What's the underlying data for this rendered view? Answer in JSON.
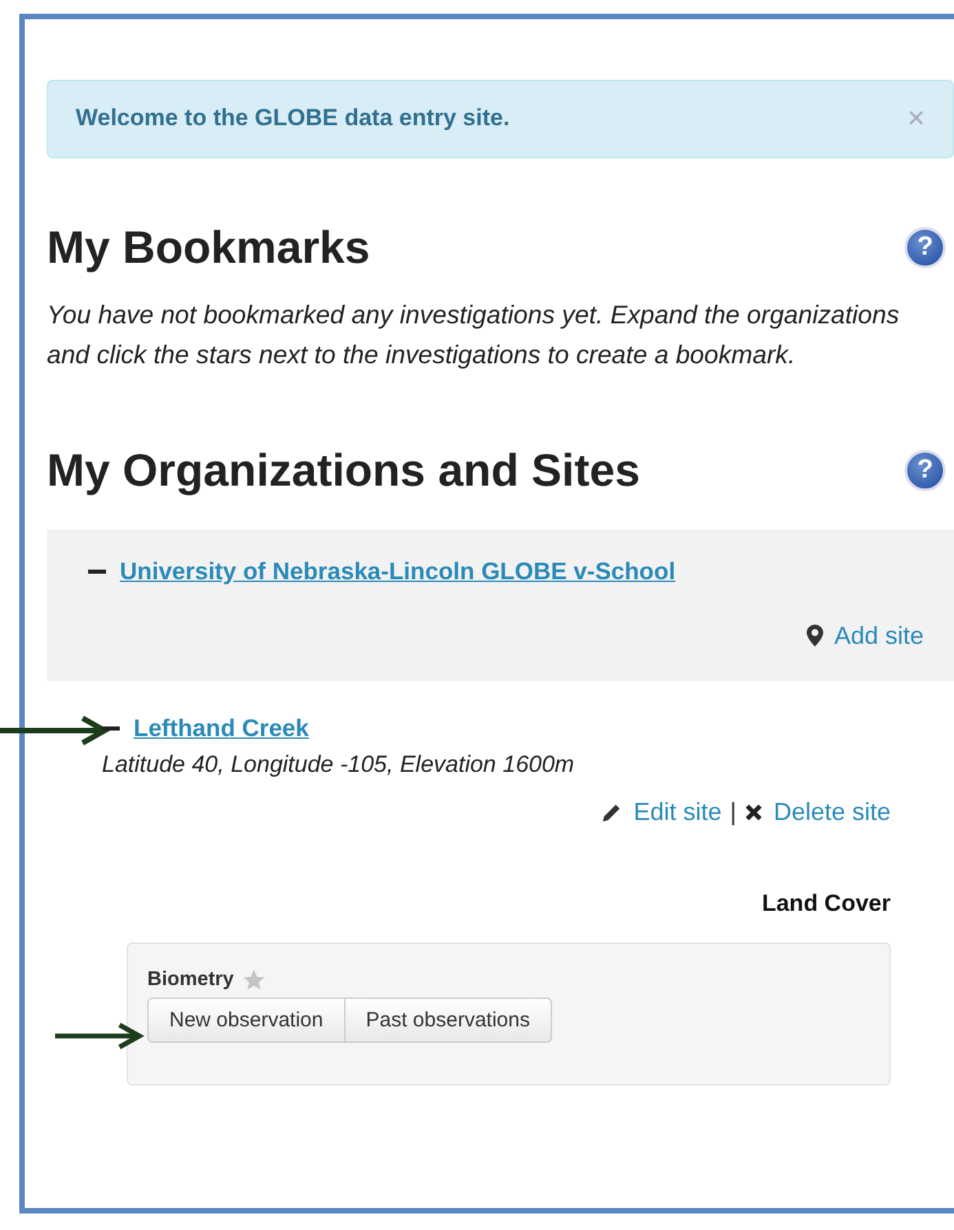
{
  "alert": {
    "text": "Welcome to the GLOBE data entry site.",
    "close": "×"
  },
  "bookmarks": {
    "title": "My Bookmarks",
    "help": "?",
    "message": "You have not bookmarked any investigations yet. Expand the organizations and click the stars next to the investigations to create a bookmark."
  },
  "organizations": {
    "title": "My Organizations and Sites",
    "help": "?",
    "items": [
      {
        "name": "University of Nebraska-Lincoln GLOBE v-School",
        "expanded": true,
        "add_site": "Add site",
        "sites": [
          {
            "name": "Lefthand Creek",
            "expanded": true,
            "annotated": true,
            "details": "Latitude 40, Longitude -105, Elevation 1600m",
            "edit": "Edit site",
            "separator": "|",
            "delete": "Delete site",
            "protocol_group": "Land Cover",
            "protocols": [
              {
                "name": "Biometry",
                "starred": false,
                "annotated": true,
                "buttons": [
                  "New observation",
                  "Past observations"
                ]
              }
            ]
          }
        ]
      }
    ]
  }
}
